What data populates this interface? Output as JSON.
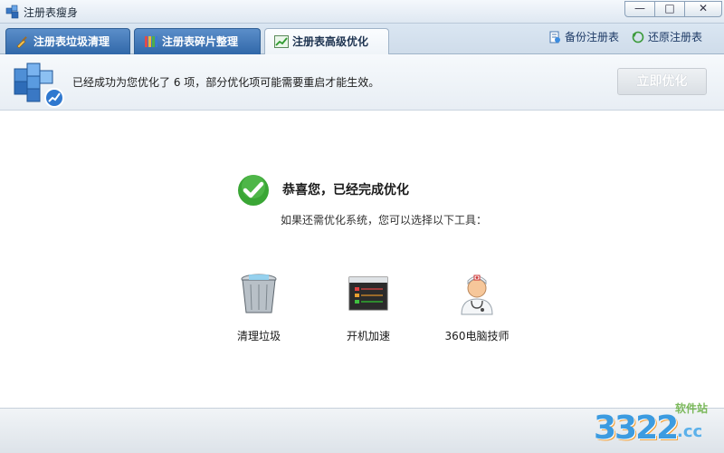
{
  "window": {
    "title": "注册表瘦身",
    "controls": {
      "minimize": "—",
      "maximize": "□",
      "close": "✕"
    }
  },
  "tabs": [
    {
      "label": "注册表垃圾清理",
      "icon": "broom-icon",
      "active": false
    },
    {
      "label": "注册表碎片整理",
      "icon": "bars-icon",
      "active": false
    },
    {
      "label": "注册表高级优化",
      "icon": "chart-up-icon",
      "active": true
    }
  ],
  "tools_links": {
    "backup": "备份注册表",
    "restore": "还原注册表"
  },
  "info": {
    "message": "已经成功为您优化了 6 项，部分优化项可能需要重启才能生效。",
    "optimize_button": "立即优化"
  },
  "result": {
    "headline": "恭喜您，已经完成优化",
    "subline": "如果还需优化系统，您可以选择以下工具："
  },
  "tools": [
    {
      "label": "清理垃圾",
      "icon": "trash-bin-icon"
    },
    {
      "label": "开机加速",
      "icon": "startup-window-icon"
    },
    {
      "label": "360电脑技师",
      "icon": "doctor-icon"
    }
  ],
  "watermark": {
    "number": "3322",
    "domain": ".cc",
    "site": "软件站"
  },
  "colors": {
    "tab_active_text": "#1d3350",
    "tab_bg": "#2f66a8",
    "accent_link": "#1d3a66",
    "check_green": "#3aa635"
  }
}
